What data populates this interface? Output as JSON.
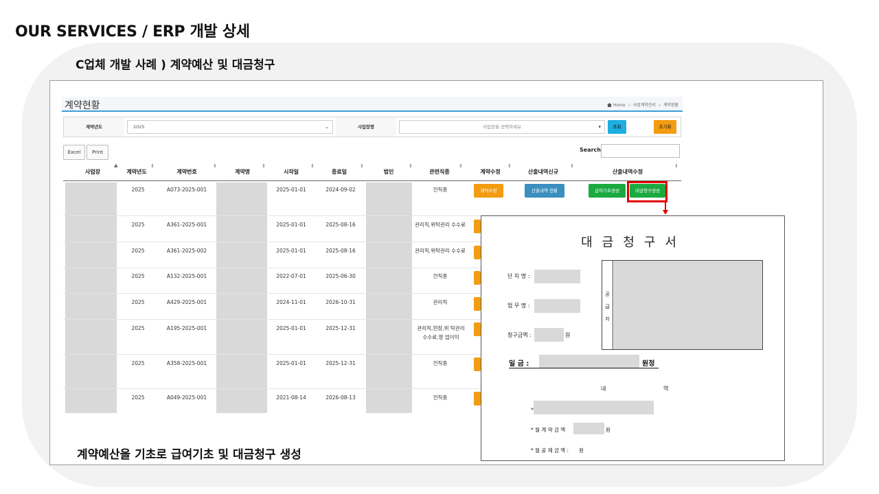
{
  "page": {
    "title": "OUR SERVICES / ERP 개발 상세",
    "case_title": "C업체 개발 사례 ) 계약예산 및 대금청구",
    "caption": "계약예산을 기초로 급여기초 및 대금청구 생성"
  },
  "app": {
    "title": "계약현황",
    "breadcrumb": [
      "Home",
      "사업계약관리",
      "계약현황"
    ]
  },
  "filter": {
    "year_label": "계약년도",
    "year_value": "2025",
    "site_label": "사업장명",
    "site_placeholder": "사업장을 선택하세요",
    "search_button": "조회",
    "reset_button": "초기화"
  },
  "toolbar": {
    "excel": "Excel",
    "print": "Print",
    "search_label": "Search:"
  },
  "table": {
    "headers": [
      "사업장",
      "계약년도",
      "계약번호",
      "계약명",
      "시작일",
      "종료일",
      "법인",
      "관련직종",
      "계약수정",
      "산출내역신규",
      "산출내역수정"
    ],
    "edit_button": "계약수정",
    "calc_button": "산출내역 현황",
    "salary_button": "급여기초생성",
    "invoice_button": "대금청구생성",
    "rows": [
      {
        "year": "2025",
        "no": "A073-2025-001",
        "start": "2025-01-01",
        "end": "2024-09-02",
        "job": "전직종"
      },
      {
        "year": "2025",
        "no": "A361-2025-001",
        "start": "2025-01-01",
        "end": "2025-08-16",
        "job": "관리직,위탁관리 수수료"
      },
      {
        "year": "2025",
        "no": "A361-2025-002",
        "start": "2025-01-01",
        "end": "2025-08-16",
        "job": "관리직,위탁관리 수수료"
      },
      {
        "year": "2025",
        "no": "A132-2025-001",
        "start": "2022-07-01",
        "end": "2025-06-30",
        "job": "전직종"
      },
      {
        "year": "2025",
        "no": "A429-2025-001",
        "start": "2024-11-01",
        "end": "2026-10-31",
        "job": "관리직"
      },
      {
        "year": "2025",
        "no": "A195-2025-001",
        "start": "2025-01-01",
        "end": "2025-12-31",
        "job": "관리직,현장,위 탁관리수수료,영 업이익"
      },
      {
        "year": "2025",
        "no": "A358-2025-001",
        "start": "2025-01-01",
        "end": "2025-12-31",
        "job": "전직종"
      },
      {
        "year": "2025",
        "no": "A049-2025-001",
        "start": "2021-08-14",
        "end": "2026-08-13",
        "job": "전직종"
      }
    ]
  },
  "invoice": {
    "title": "대금청구서",
    "complex_label": "단 지 명 :",
    "task_label": "업 무 명 :",
    "amount_label": "청구금액 :",
    "won": "원",
    "supplier_chars": [
      "공",
      "급",
      "자"
    ],
    "ilgum": "일    금 :",
    "wonjung": "원정",
    "detail_left": "내",
    "detail_right": "역",
    "bullet": "*",
    "monthly_contract": "* 월 계 약 금 액",
    "monthly_deduct": "* 월 공 제 금 액 :",
    "won_end": "원"
  }
}
